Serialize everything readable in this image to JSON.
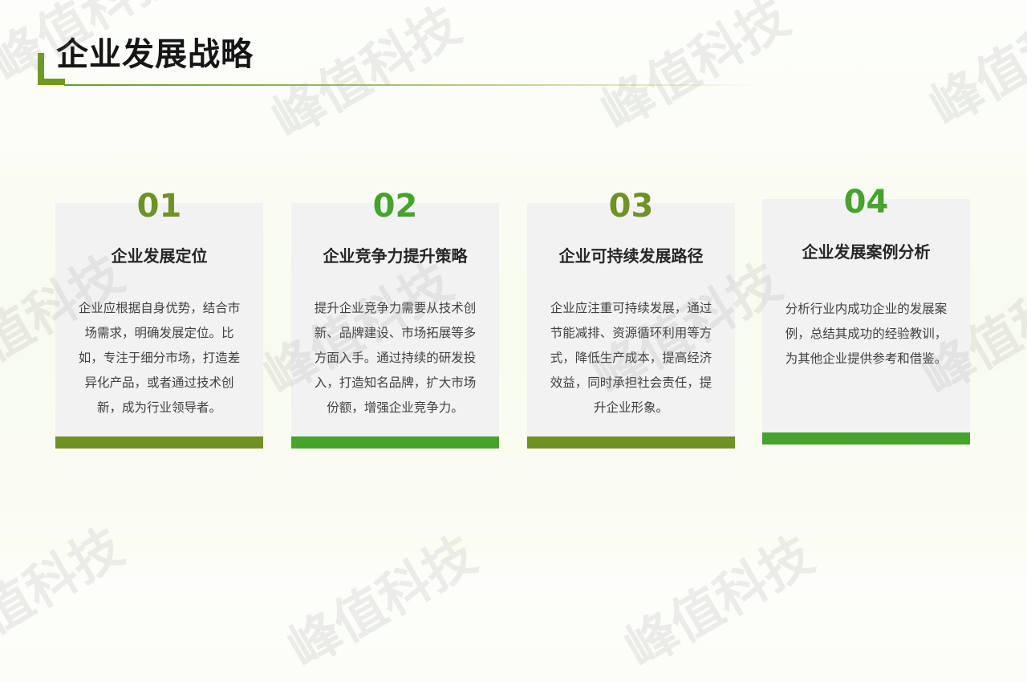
{
  "page": {
    "title": "企业发展战略"
  },
  "watermark": {
    "text": "峰值科技"
  },
  "colors": {
    "olive_green": "#6e9224",
    "bright_green": "#46a32c",
    "title_accent": "#6d9a1f",
    "card_bg": "#f2f2f2"
  },
  "cards": [
    {
      "number": "01",
      "title": "企业发展定位",
      "body": "企业应根据自身优势，结合市场需求，明确发展定位。比如，专注于细分市场，打造差异化产品，或者通过技术创新，成为行业领导者。",
      "accent": "#6e9224"
    },
    {
      "number": "02",
      "title": "企业竞争力提升策略",
      "body": "提升企业竞争力需要从技术创新、品牌建设、市场拓展等多方面入手。通过持续的研发投入，打造知名品牌，扩大市场份额，增强企业竞争力。",
      "accent": "#46a32c"
    },
    {
      "number": "03",
      "title": "企业可持续发展路径",
      "body": "企业应注重可持续发展，通过节能减排、资源循环利用等方式，降低生产成本，提高经济效益，同时承担社会责任，提升企业形象。",
      "accent": "#6e9224"
    },
    {
      "number": "04",
      "title": "企业发展案例分析",
      "body": "分析行业内成功企业的发展案例，总结其成功的经验教训，为其他企业提供参考和借鉴。",
      "accent": "#46a32c"
    }
  ]
}
